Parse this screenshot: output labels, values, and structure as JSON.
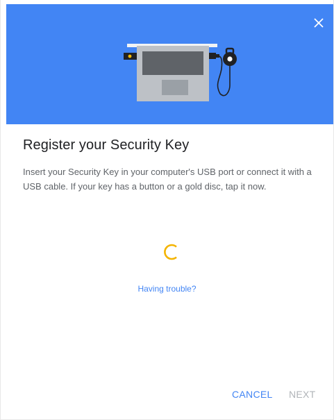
{
  "dialog": {
    "title": "Register your Security Key",
    "instructions": "Insert your Security Key in your computer's USB port or connect it with a USB cable. If your key has a button or a gold disc, tap it now.",
    "trouble_link": "Having trouble?",
    "close_icon": "close-icon",
    "illustration": "laptop-with-security-key-illustration",
    "spinner_icon": "loading-spinner-icon"
  },
  "actions": {
    "cancel_label": "CANCEL",
    "next_label": "NEXT"
  },
  "colors": {
    "banner": "#4285f4",
    "spinner": "#f4b400",
    "link": "#4285f4",
    "disabled": "#b0b4b8"
  }
}
